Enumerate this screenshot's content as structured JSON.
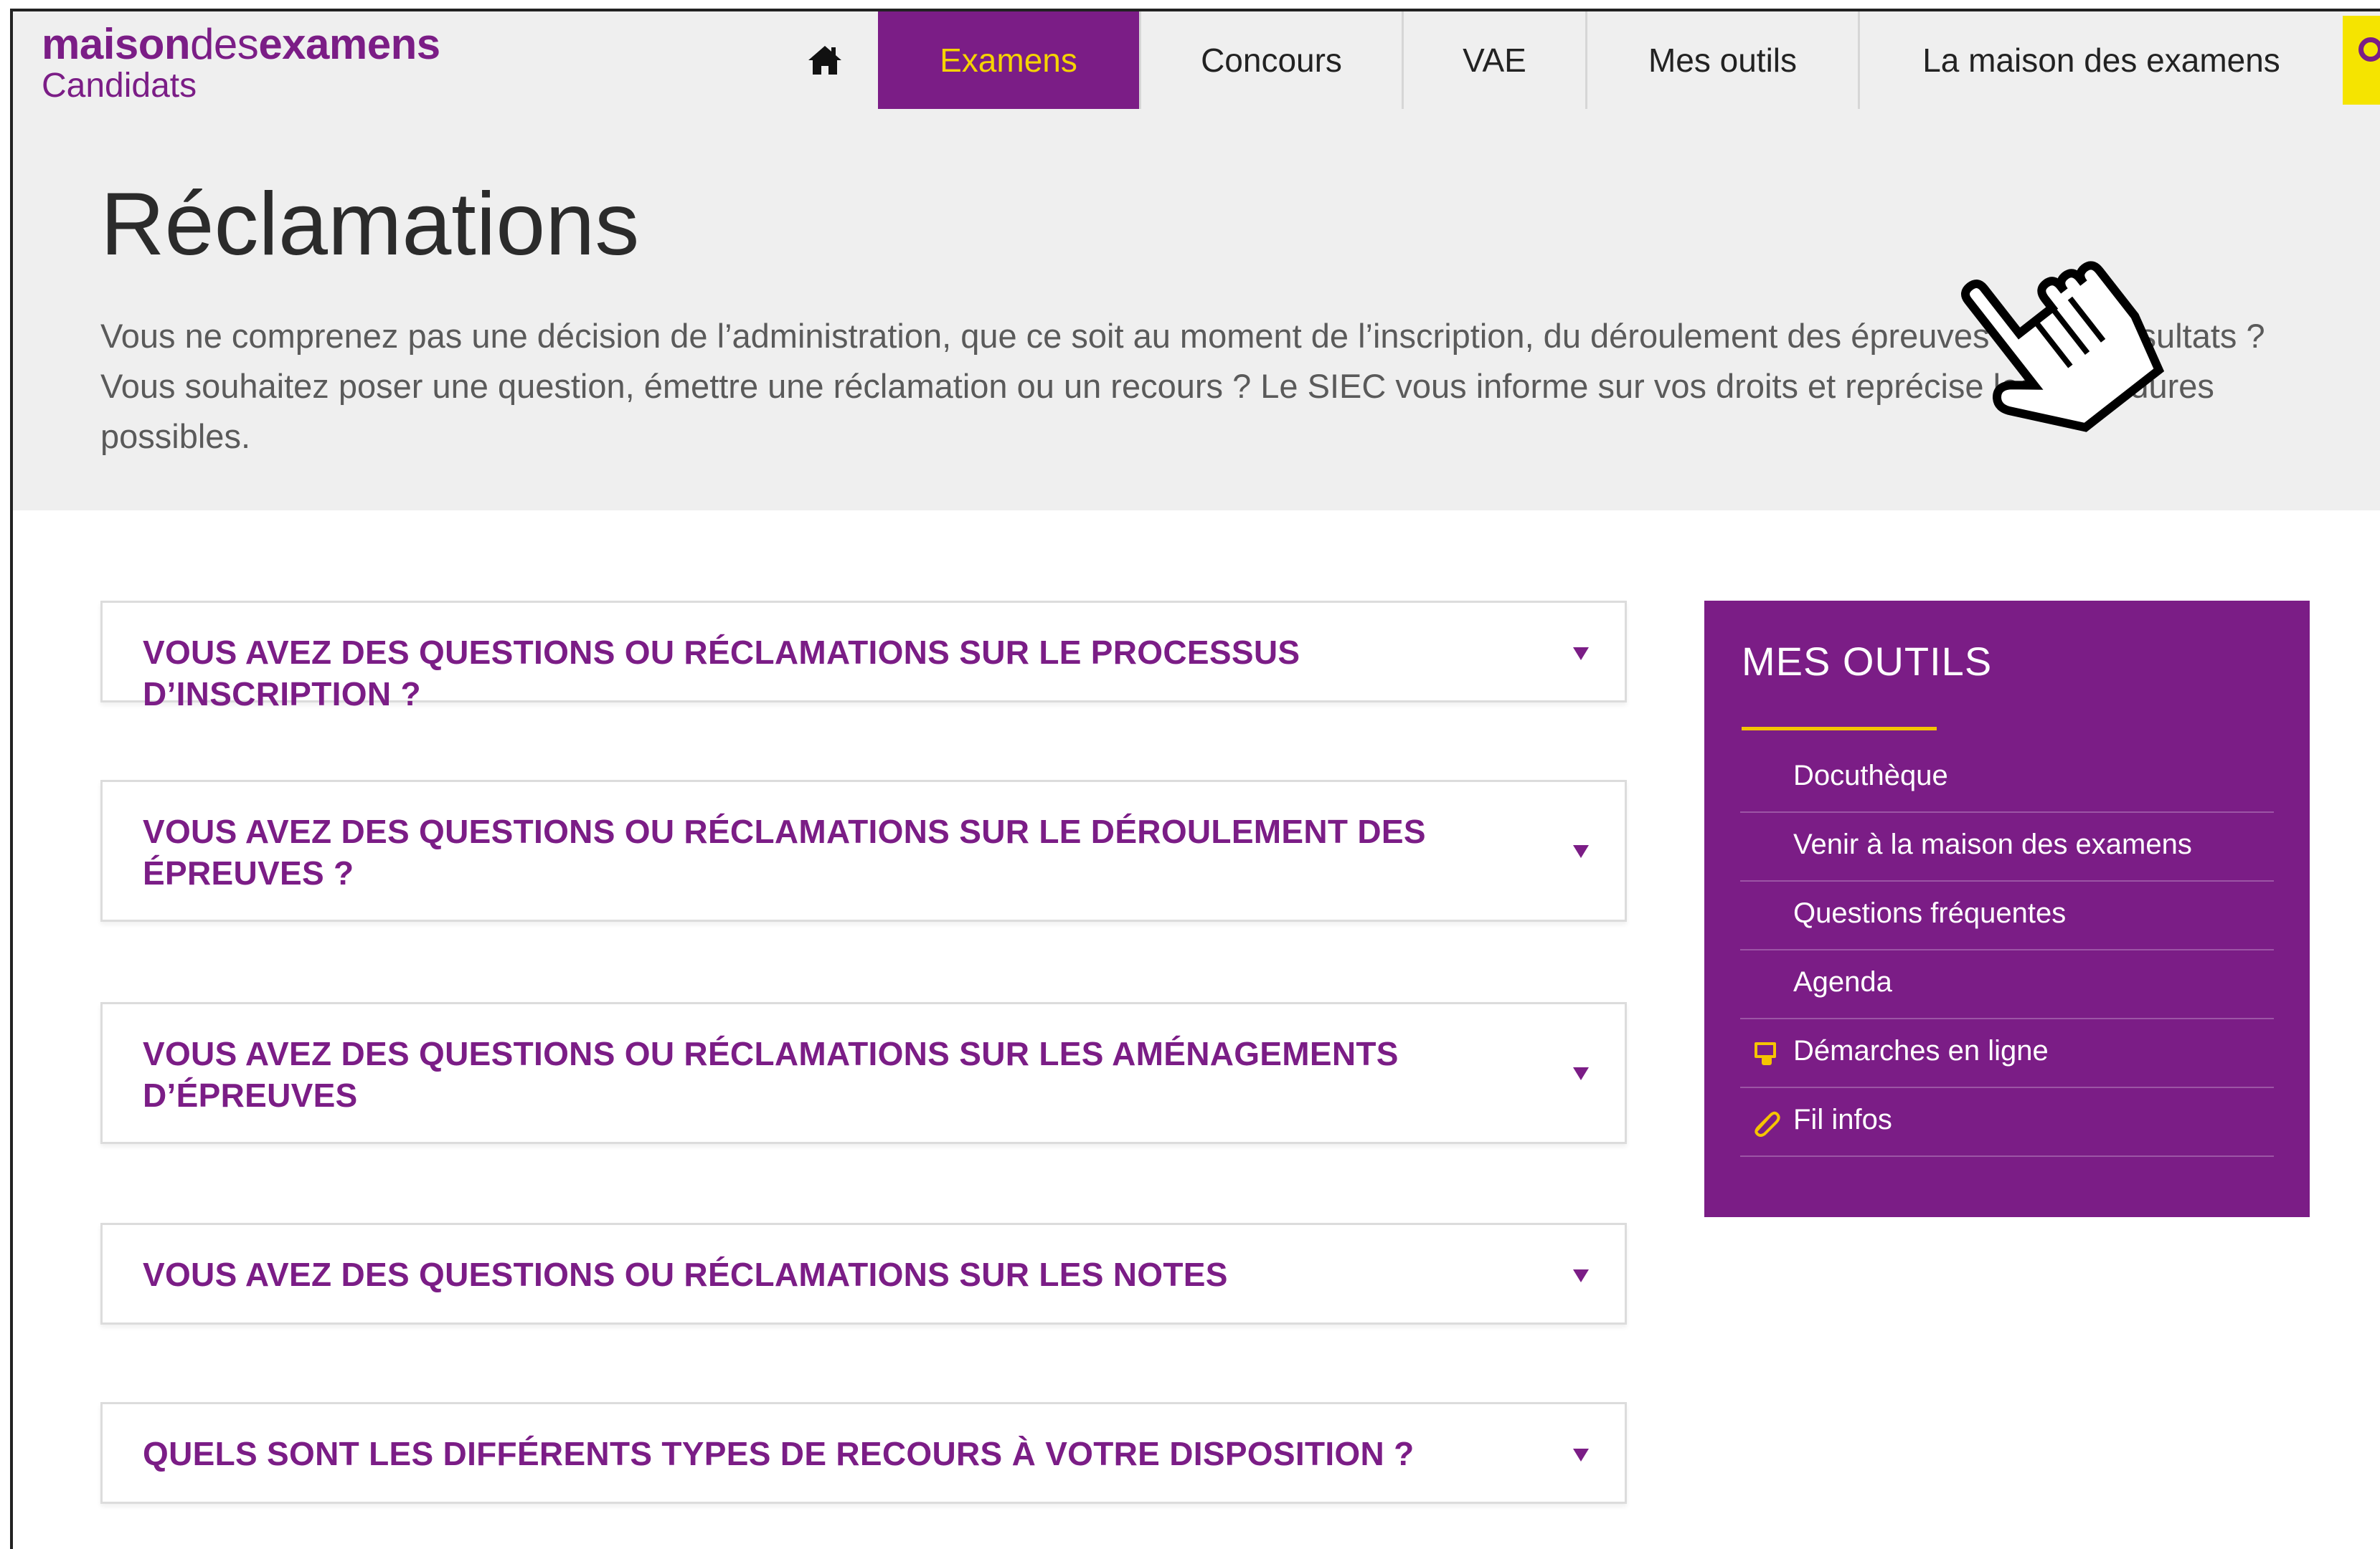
{
  "header": {
    "logo": {
      "part1": "maison",
      "part2": "des",
      "part3": "examens",
      "subtitle": "Candidats"
    },
    "nav": [
      {
        "label": "Examens",
        "active": true
      },
      {
        "label": "Concours",
        "active": false
      },
      {
        "label": "VAE",
        "active": false
      },
      {
        "label": "Mes outils",
        "active": false
      },
      {
        "label": "La maison des examens",
        "active": false
      }
    ]
  },
  "hero": {
    "title": "Réclamations",
    "description": "Vous ne comprenez pas une décision de l’administration, que ce soit au moment de l’inscription, du déroulement des épreuves ou des résultats ? Vous souhaitez poser une question, émettre une réclamation ou un recours ? Le SIEC vous informe sur vos droits et reprécise les procédures possibles."
  },
  "accordion": [
    {
      "title": "VOUS AVEZ DES QUESTIONS OU RÉCLAMATIONS SUR LE PROCESSUS D’INSCRIPTION ?"
    },
    {
      "title": "VOUS AVEZ DES QUESTIONS OU RÉCLAMATIONS SUR LE DÉROULEMENT DES ÉPREUVES ?"
    },
    {
      "title": "VOUS AVEZ DES QUESTIONS OU RÉCLAMATIONS SUR LES AMÉNAGEMENTS D’ÉPREUVES"
    },
    {
      "title": "VOUS AVEZ DES QUESTIONS OU RÉCLAMATIONS SUR LES NOTES"
    },
    {
      "title": "QUELS SONT LES DIFFÉRENTS TYPES DE RECOURS À VOTRE DISPOSITION ?"
    }
  ],
  "tools": {
    "heading": "MES OUTILS",
    "items": [
      {
        "label": "Docuthèque",
        "icon": ""
      },
      {
        "label": "Venir à la maison des examens",
        "icon": ""
      },
      {
        "label": "Questions fréquentes",
        "icon": ""
      },
      {
        "label": "Agenda",
        "icon": ""
      },
      {
        "label": "Démarches en ligne",
        "icon": "monitor-hand-icon"
      },
      {
        "label": "Fil infos",
        "icon": "paperclip-icon"
      }
    ]
  },
  "colors": {
    "brand": "#7b1d86",
    "accent": "#f5d300",
    "hero_bg": "#efefef"
  }
}
